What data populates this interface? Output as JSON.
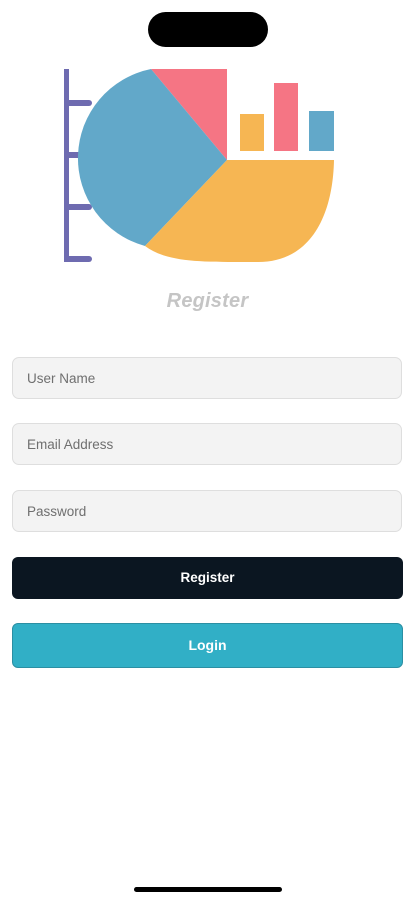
{
  "screen": {
    "title": "Register"
  },
  "form": {
    "username_placeholder": "User Name",
    "email_placeholder": "Email Address",
    "password_placeholder": "Password"
  },
  "buttons": {
    "register_label": "Register",
    "login_label": "Login"
  },
  "logo": {
    "icon": "chart-logo-icon",
    "colors": {
      "ruler": "#6e6bb0",
      "pie_blue": "#62a8c9",
      "pie_red": "#f57584",
      "pie_yellow": "#f6b653",
      "bar_yellow": "#f6b653",
      "bar_red": "#f57584",
      "bar_blue": "#62a8c9"
    }
  },
  "colors": {
    "register_button": "#0b1621",
    "login_button": "#31afc6",
    "title_text": "#c5c5c5",
    "field_background": "#f3f3f3"
  }
}
